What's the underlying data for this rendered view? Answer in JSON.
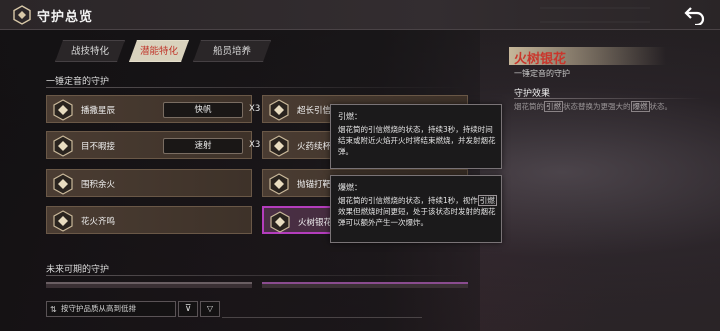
{
  "header": {
    "title": "守护总览",
    "back_icon": "return-arrow-icon"
  },
  "tabs": [
    {
      "label": "战技特化",
      "active": false
    },
    {
      "label": "潜能特化",
      "active": true
    },
    {
      "label": "船员培养",
      "active": false
    }
  ],
  "sections": {
    "current": "一锤定音的守护",
    "future": "未来可期的守护"
  },
  "cards": [
    {
      "name": "播撒星辰",
      "slot": "快帆",
      "mult": "X3"
    },
    {
      "name": "目不暇接",
      "slot": "速射",
      "mult": "X3"
    },
    {
      "name": "围积余火"
    },
    {
      "name": "花火齐鸣"
    },
    {
      "name": "超长引信"
    },
    {
      "name": "火药续杯"
    },
    {
      "name": "抛锚打靶"
    },
    {
      "name": "火树银花",
      "selected": true
    }
  ],
  "controls": {
    "sort_label": "按守护品质从高到低排",
    "filter_icon": "filter-icon",
    "clear_icon": "clear-filter-icon"
  },
  "detail": {
    "title": "火树银花",
    "subtitle": "一锤定音的守护",
    "effect_title": "守护效果",
    "desc_pre": "烟花筒的",
    "desc_kw1": "引燃",
    "desc_mid": "状态替换为更强大的",
    "desc_kw2": "爆燃",
    "desc_post": "状态。"
  },
  "tooltips": [
    {
      "title": "引燃：",
      "body": "烟花筒的引信燃烧的状态，持续3秒，持续时间结束或附近火焰开火时将结束燃烧，并发射烟花弹。"
    },
    {
      "title": "爆燃：",
      "body_pre": "烟花筒的引信燃烧的状态，持续1秒，视作",
      "body_kw": "引燃",
      "body_post": "效果但燃烧时间更短，处于该状态时发射的烟花弹可以额外产生一次爆炸。"
    }
  ],
  "colors": {
    "accent_red": "#c9362c",
    "selected_purple": "#b43dbd",
    "card_bg": "#4a3c32"
  }
}
